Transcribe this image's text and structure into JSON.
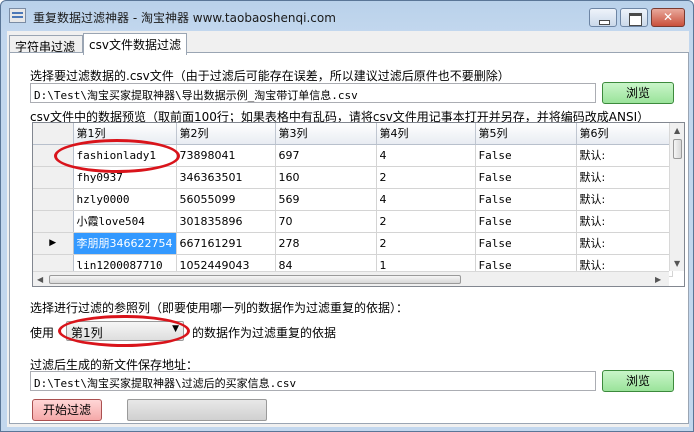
{
  "window": {
    "title": "重复数据过滤神器 - 淘宝神器 www.taobaoshenqi.com"
  },
  "tabs": [
    {
      "label": "字符串过滤"
    },
    {
      "label": "csv文件数据过滤"
    }
  ],
  "file_select": {
    "label": "选择要过滤数据的.csv文件（由于过滤后可能存在误差，所以建议过滤后原件也不要删除）",
    "path": "D:\\Test\\淘宝买家提取神器\\导出数据示例_淘宝带订单信息.csv",
    "browse_label": "浏览"
  },
  "preview": {
    "label": "csv文件中的数据预览（取前面100行；如果表格中有乱码，请将csv文件用记事本打开并另存，并将编码改成ANSI）",
    "columns": [
      "第1列",
      "第2列",
      "第3列",
      "第4列",
      "第5列",
      "第6列"
    ],
    "rows": [
      [
        "fashionlady1",
        "73898041",
        "697",
        "4",
        "False",
        "默认:"
      ],
      [
        "fhy0937",
        "346363501",
        "160",
        "2",
        "False",
        "默认:"
      ],
      [
        "hzly0000",
        "56055099",
        "569",
        "4",
        "False",
        "默认:"
      ],
      [
        "小霞love504",
        "301835896",
        "70",
        "2",
        "False",
        "默认:"
      ],
      [
        "李朋朋346622754",
        "667161291",
        "278",
        "2",
        "False",
        "默认:"
      ],
      [
        "lin1200087710",
        "1052449043",
        "84",
        "1",
        "False",
        "默认:"
      ]
    ],
    "current_row_marker": "▶"
  },
  "reference": {
    "label": "选择进行过滤的参照列（即要使用哪一列的数据作为过滤重复的依据）：",
    "use_label": "使用",
    "selected": "第1列",
    "suffix": "的数据作为过滤重复的依据"
  },
  "output": {
    "label": "过滤后生成的新文件保存地址：",
    "path": "D:\\Test\\淘宝买家提取神器\\过滤后的买家信息.csv",
    "browse_label": "浏览"
  },
  "actions": {
    "start_label": "开始过滤",
    "progress": 0
  },
  "colors": {
    "highlight_ellipse": "#d9141b",
    "selection": "#3399ff",
    "green_button": "#9ae39a",
    "pink_button": "#f5a9a9"
  }
}
